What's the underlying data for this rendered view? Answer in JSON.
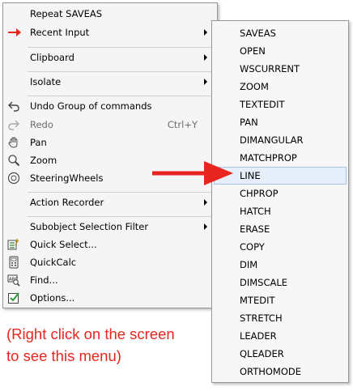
{
  "main_menu": {
    "items": [
      {
        "label": "Repeat SAVEAS"
      },
      {
        "label": "Recent Input"
      },
      {
        "label": "Clipboard"
      },
      {
        "label": "Isolate"
      },
      {
        "label": "Undo Group of commands"
      },
      {
        "label": "Redo",
        "shortcut": "Ctrl+Y"
      },
      {
        "label": "Pan"
      },
      {
        "label": "Zoom"
      },
      {
        "label": "SteeringWheels"
      },
      {
        "label": "Action Recorder"
      },
      {
        "label": "Subobject Selection Filter"
      },
      {
        "label": "Quick Select..."
      },
      {
        "label": "QuickCalc"
      },
      {
        "label": "Find..."
      },
      {
        "label": "Options..."
      }
    ]
  },
  "recent_input_menu": {
    "items": [
      "SAVEAS",
      "OPEN",
      "WSCURRENT",
      "ZOOM",
      "TEXTEDIT",
      "PAN",
      "DIMANGULAR",
      "MATCHPROP",
      "LINE",
      "CHPROP",
      "HATCH",
      "ERASE",
      "COPY",
      "DIM",
      "DIMSCALE",
      "MTEDIT",
      "STRETCH",
      "LEADER",
      "QLEADER",
      "ORTHOMODE"
    ],
    "highlighted": "LINE"
  },
  "caption": {
    "line1": "(Right click on the screen",
    "line2": "to see this menu)"
  },
  "colors": {
    "annotation_red": "#e8261f",
    "highlight_bg": "#e6eef9",
    "highlight_border": "#a9c4e8"
  },
  "icons": [
    "arrow-small-icon",
    "undo-icon",
    "redo-icon",
    "pan-hand-icon",
    "zoom-icon",
    "steeringwheels-icon",
    "quick-select-icon",
    "quickcalc-icon",
    "find-icon",
    "options-icon",
    "red-pointer-arrow-icon"
  ]
}
